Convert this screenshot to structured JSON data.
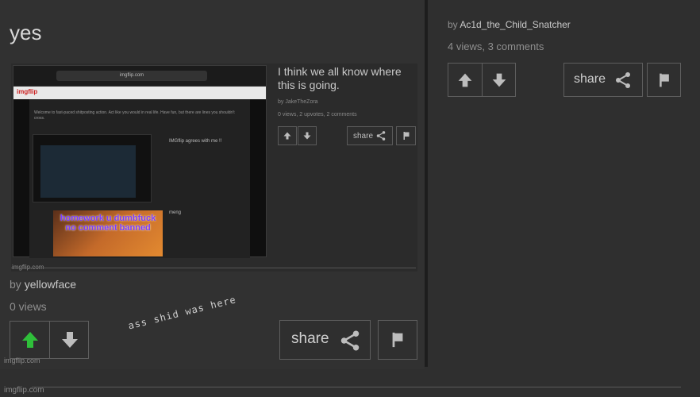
{
  "post": {
    "title": "yes",
    "by_prefix": "by",
    "username": "yellowface",
    "views": "0 views",
    "share_label": "share",
    "handwritten_note": "ass shid was here",
    "watermark": "imgflip.com"
  },
  "embedded": {
    "url": "imgflip.com",
    "logo": "imgflip",
    "caption": "I think we all know where this is going.",
    "by_line": "by JakeTheZora",
    "stats": "0 views, 2 upvotes, 2 comments",
    "share_label": "share",
    "body_text": "Welcome to fast-paced shitposting action. Act like you would in real life. Have fun, but there are lines you shouldn't cross.",
    "mini_title_1": "IMGflip agrees with me !!",
    "mini_title_2": "meng",
    "meme_text": "homework u dumbfuck no comment banned",
    "watermark": "imgflip.com"
  },
  "right": {
    "by_prefix": "by",
    "username": "Ac1d_the_Child_Snatcher",
    "stats": "4 views, 3 comments",
    "share_label": "share"
  },
  "footer": {
    "watermark": "imgflip.com"
  },
  "colors": {
    "background": "#2f2f2f",
    "upvote_active": "#2fbf3a",
    "text": "#cfcfcf"
  }
}
